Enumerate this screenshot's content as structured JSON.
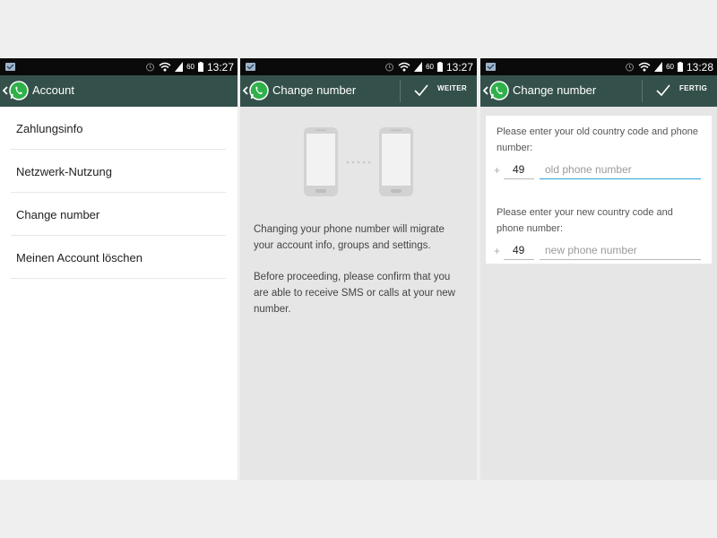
{
  "status": {
    "time_1": "13:27",
    "time_2": "13:27",
    "time_3": "13:28",
    "network": "60"
  },
  "screen1": {
    "title": "Account",
    "items": [
      {
        "label": "Zahlungsinfo"
      },
      {
        "label": "Netzwerk-Nutzung"
      },
      {
        "label": "Change number"
      },
      {
        "label": "Meinen Account löschen"
      }
    ]
  },
  "screen2": {
    "title": "Change number",
    "action": "WEITER",
    "paragraph1": "Changing your phone number will migrate your account info, groups and settings.",
    "paragraph2": "Before proceeding, please confirm that you are able to receive SMS or calls at your new number."
  },
  "screen3": {
    "title": "Change number",
    "action": "FERTIG",
    "old_label": "Please enter your old country code and phone number:",
    "new_label": "Please enter your new country code and phone number:",
    "plus": "+",
    "old_cc": "49",
    "new_cc": "49",
    "old_placeholder": "old phone number",
    "new_placeholder": "new phone number"
  },
  "colors": {
    "actionbar": "#34504a",
    "whatsapp_green": "#2fb14a",
    "focus_blue": "#2aa4d8"
  }
}
